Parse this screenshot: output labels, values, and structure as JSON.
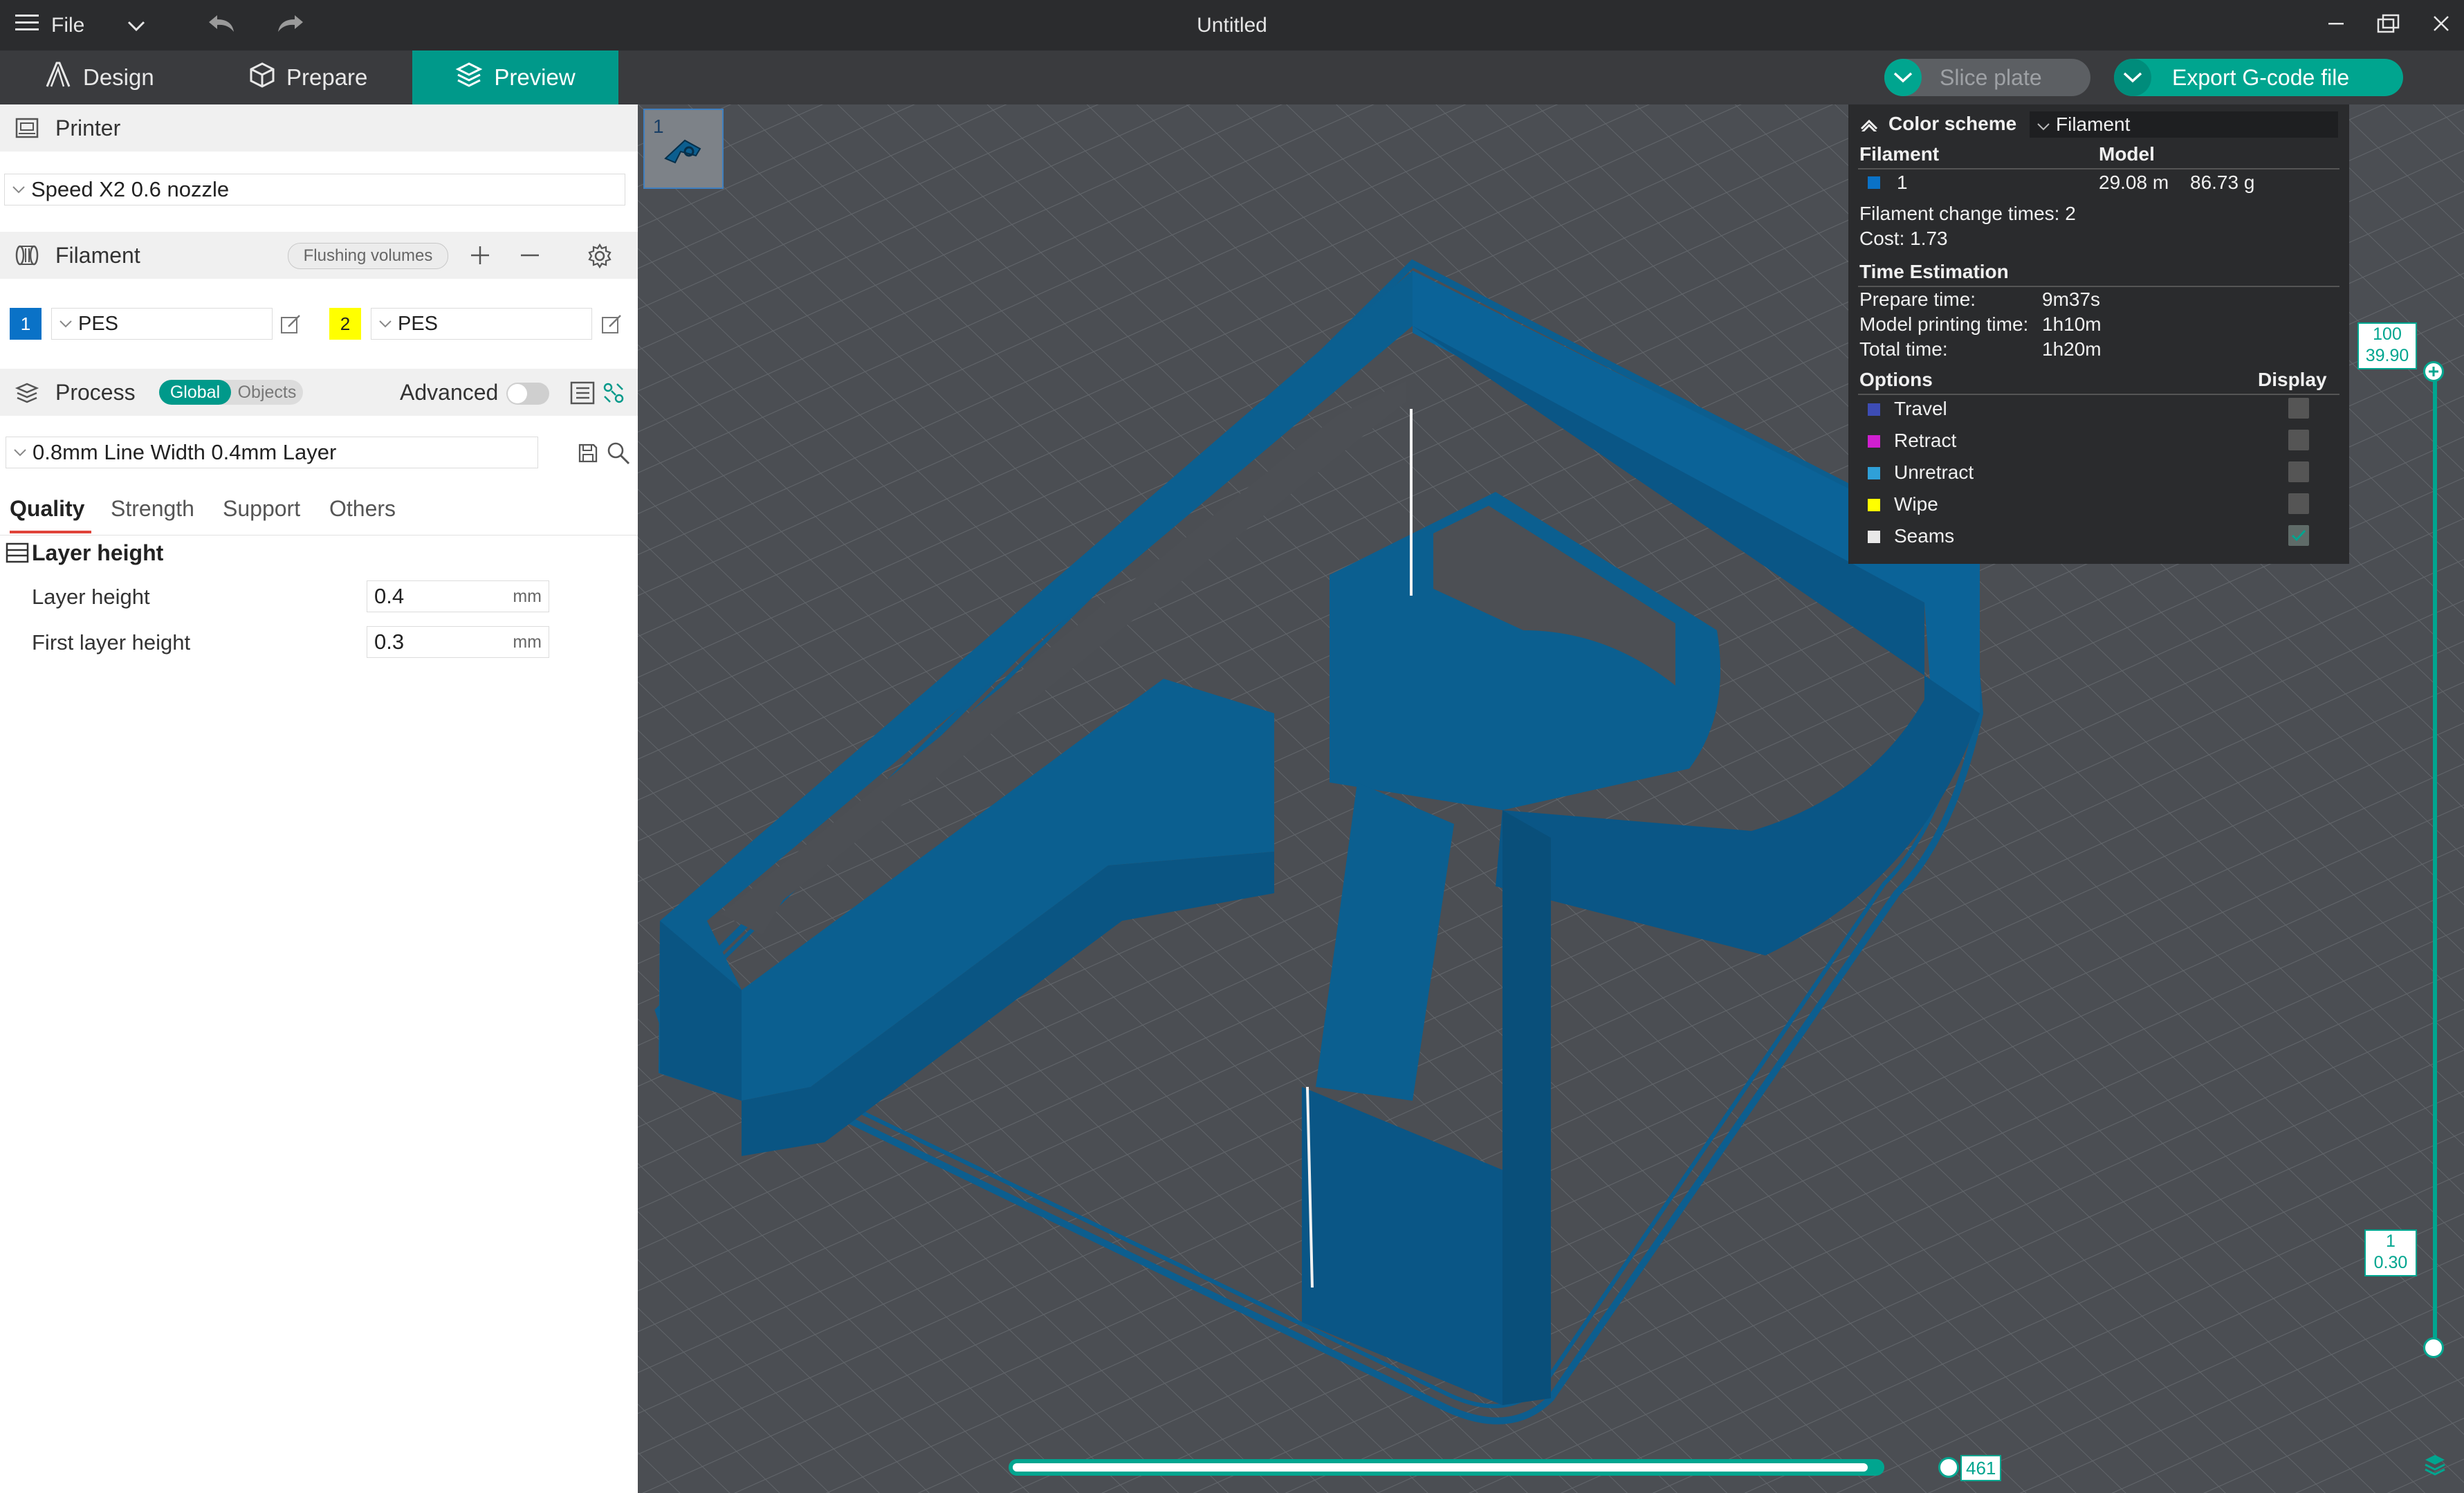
{
  "titlebar": {
    "menu_label": "File",
    "title": "Untitled"
  },
  "tabs": [
    {
      "label": "Design"
    },
    {
      "label": "Prepare"
    },
    {
      "label": "Preview"
    }
  ],
  "toolbar": {
    "slice_label": "Slice plate",
    "export_label": "Export G-code file"
  },
  "printer": {
    "section_title": "Printer",
    "selected": "Speed X2 0.6 nozzle"
  },
  "filament": {
    "section_title": "Filament",
    "flushing_label": "Flushing volumes",
    "slots": [
      {
        "index": "1",
        "type": "PES",
        "color": "#0a72c7"
      },
      {
        "index": "2",
        "type": "PES",
        "color": "#ffff00"
      }
    ]
  },
  "process": {
    "section_title": "Process",
    "global_label": "Global",
    "objects_label": "Objects",
    "advanced_label": "Advanced",
    "preset": "0.8mm Line Width 0.4mm Layer",
    "subtabs": [
      "Quality",
      "Strength",
      "Support",
      "Others"
    ],
    "group_title": "Layer height",
    "params": [
      {
        "label": "Layer height",
        "value": "0.4",
        "unit": "mm"
      },
      {
        "label": "First layer height",
        "value": "0.3",
        "unit": "mm"
      }
    ]
  },
  "viewport": {
    "plate_number": "1",
    "model_color": "#0c5e8f"
  },
  "legend": {
    "color_scheme_label": "Color scheme",
    "color_scheme_value": "Filament",
    "col_filament": "Filament",
    "col_model": "Model",
    "rows": [
      {
        "index": "1",
        "length": "29.08 m",
        "weight": "86.73 g",
        "color": "#0a72c7"
      }
    ],
    "change_times": "Filament change times: 2",
    "cost": "Cost: 1.73",
    "time_title": "Time Estimation",
    "times": [
      {
        "label": "Prepare time:",
        "value": "9m37s"
      },
      {
        "label": "Model printing time:",
        "value": "1h10m"
      },
      {
        "label": "Total time:",
        "value": "1h20m"
      }
    ],
    "options_title": "Options",
    "display_title": "Display",
    "options": [
      {
        "label": "Travel",
        "color": "#3d4cb5",
        "checked": false
      },
      {
        "label": "Retract",
        "color": "#d01fd0",
        "checked": false
      },
      {
        "label": "Unretract",
        "color": "#2fa0d8",
        "checked": false
      },
      {
        "label": "Wipe",
        "color": "#ffff00",
        "checked": false
      },
      {
        "label": "Seams",
        "color": "#e8e8e8",
        "checked": true
      }
    ]
  },
  "layer_slider": {
    "top_layer": "100",
    "top_height": "39.90",
    "bottom_layer": "1",
    "bottom_height": "0.30"
  },
  "move_slider": {
    "value": "461"
  },
  "colors": {
    "accent": "#00998a",
    "accent_light": "#00a58f"
  }
}
